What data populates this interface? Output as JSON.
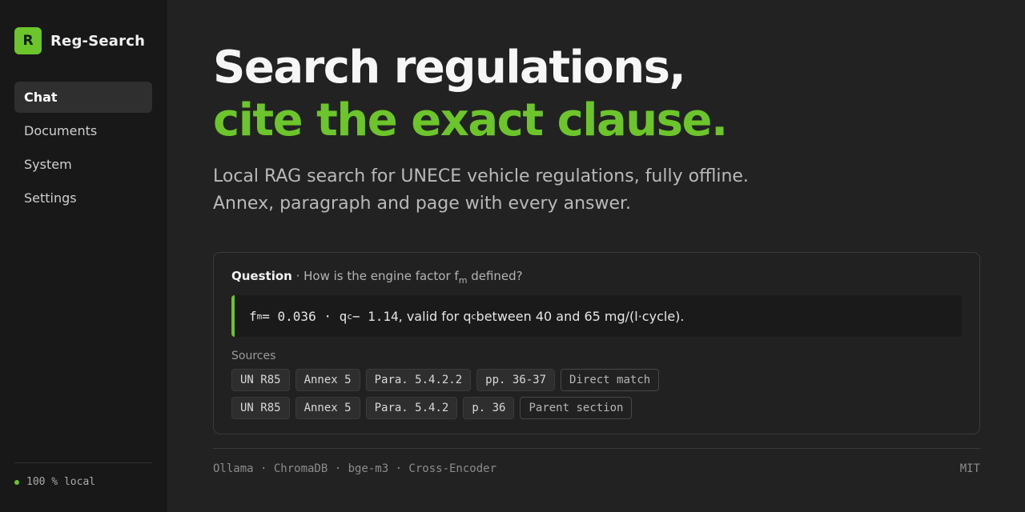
{
  "brand": {
    "logo_letter": "R",
    "name": "Reg-Search",
    "accent_color": "#6cc52a"
  },
  "nav": {
    "items": [
      {
        "label": "Chat",
        "active": true
      },
      {
        "label": "Documents",
        "active": false
      },
      {
        "label": "System",
        "active": false
      },
      {
        "label": "Settings",
        "active": false
      }
    ]
  },
  "status": {
    "text": "100 % local"
  },
  "hero": {
    "line1": "Search regulations,",
    "line2": "cite the exact clause.",
    "subtitle_line1": "Local RAG search for UNECE vehicle regulations, fully offline.",
    "subtitle_line2": "Annex, paragraph and page with every answer."
  },
  "card": {
    "question_label": "Question",
    "question_sep": " · ",
    "question_pre": "How is the engine factor f",
    "question_sub": "m",
    "question_post": " defined?",
    "answer": {
      "f": "f",
      "f_sub": "m",
      "formula_mid": " = 0.036 · q",
      "q_sub": "c",
      "formula_end": " − 1.14",
      "text_pre": ", valid for q",
      "text_sub": "c",
      "text_post": " between 40 and 65 mg/(l·cycle)."
    },
    "sources_label": "Sources",
    "sources": [
      {
        "chips": [
          "UN R85",
          "Annex 5",
          "Para. 5.4.2.2",
          "pp. 36-37"
        ],
        "match": "Direct match"
      },
      {
        "chips": [
          "UN R85",
          "Annex 5",
          "Para. 5.4.2",
          "p. 36"
        ],
        "match": "Parent section"
      }
    ]
  },
  "footer": {
    "stack": "Ollama · ChromaDB · bge-m3 · Cross-Encoder",
    "license": "MIT"
  }
}
